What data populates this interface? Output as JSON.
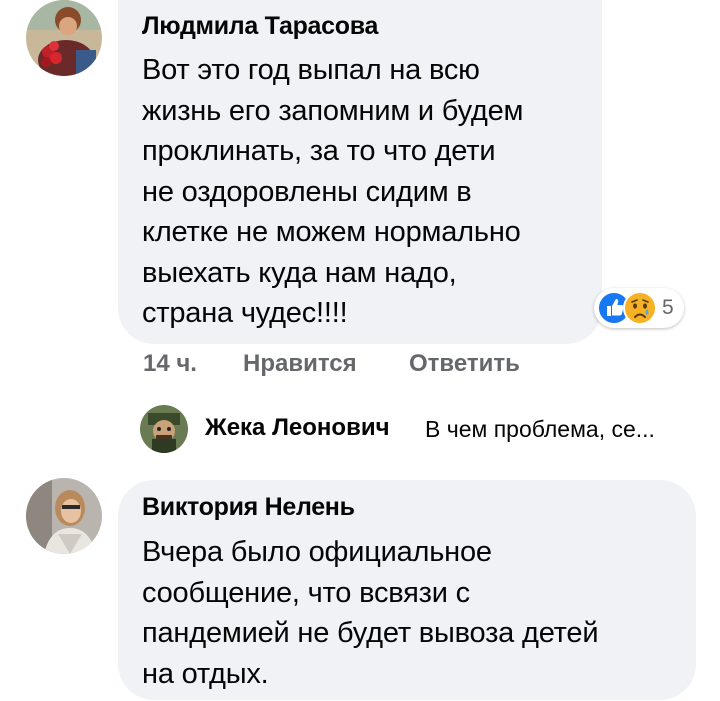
{
  "comments": [
    {
      "author": "Людмила Тарасова",
      "lines": [
        "Вот это год выпал на всю",
        "жизнь его запомним и будем",
        "проклинать, за то что дети",
        "не оздоровлены сидим в",
        "клетке не можем нормально",
        "выехать куда нам надо,",
        "страна чудес!!!!"
      ],
      "reactions": {
        "icons": [
          "like-icon",
          "sad-icon"
        ],
        "count": "5"
      },
      "time": "14 ч.",
      "like_label": "Нравится",
      "reply_label": "Ответить"
    },
    {
      "author": "Виктория Нелень",
      "lines": [
        "Вчера было официальное",
        "сообщение, что всвязи с",
        "пандемией не будет вывоза детей",
        "на отдых."
      ]
    }
  ],
  "reply_preview": {
    "author": "Жека Леонович",
    "text": "В чем проблема, се..."
  },
  "colors": {
    "bubble": "#f0f2f5",
    "meta": "#65676b",
    "like_blue": "#1877f2",
    "sad_yellow": "#f7b125"
  }
}
